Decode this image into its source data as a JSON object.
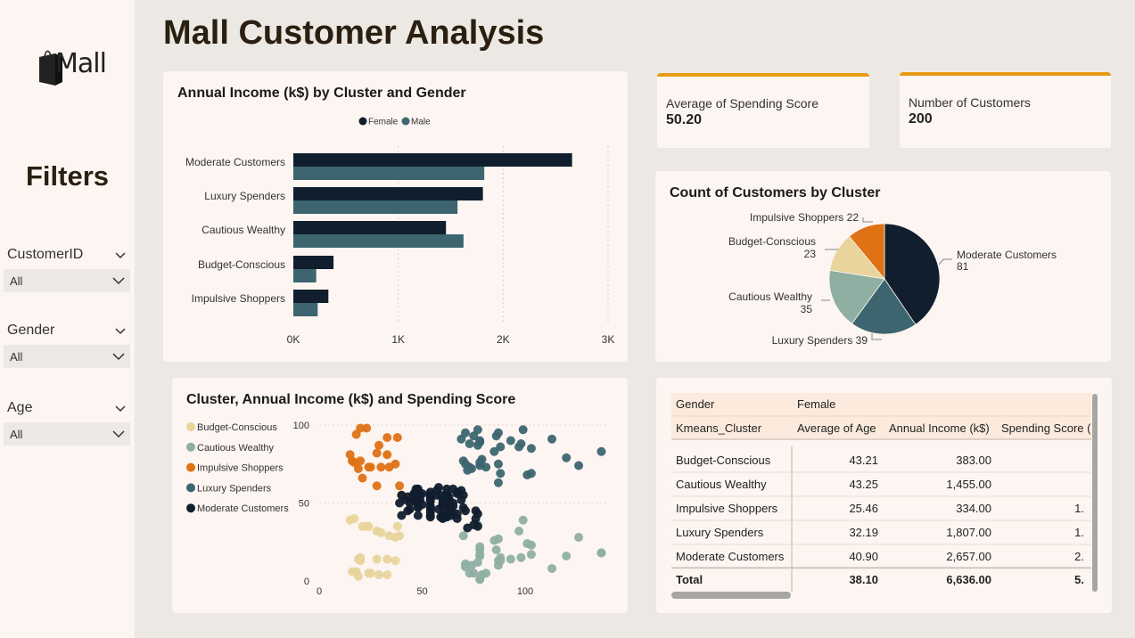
{
  "logo": {
    "text": "Mall"
  },
  "page_title": "Mall Customer Analysis",
  "filters": {
    "title": "Filters",
    "items": [
      {
        "label": "CustomerID",
        "value": "All"
      },
      {
        "label": "Gender",
        "value": "All"
      },
      {
        "label": "Age",
        "value": "All"
      }
    ]
  },
  "kpis": [
    {
      "label": "Average of Spending Score",
      "value": "50.20"
    },
    {
      "label": "Number of Customers",
      "value": "200"
    }
  ],
  "colors": {
    "female": "#111E2E",
    "male": "#3D6570",
    "budget": "#E8D49C",
    "cautious": "#8FAFA3",
    "impulsive": "#DE7215",
    "luxury": "#3D6570",
    "moderate": "#111E2E",
    "accent": "#E89A13"
  },
  "chart_data": [
    {
      "type": "bar",
      "orientation": "horizontal",
      "title": "Annual Income (k$) by Cluster and Gender",
      "categories": [
        "Moderate Customers",
        "Luxury Spenders",
        "Cautious Wealthy",
        "Budget-Conscious",
        "Impulsive Shoppers"
      ],
      "series": [
        {
          "name": "Female",
          "values": [
            2657,
            1807,
            1455,
            383,
            334
          ]
        },
        {
          "name": "Male",
          "values": [
            1820,
            1565,
            1622,
            218,
            232
          ]
        }
      ],
      "xlim": [
        0,
        3000
      ],
      "xticks": [
        "0K",
        "1K",
        "2K",
        "3K"
      ],
      "legend": "top-center",
      "grid": true
    },
    {
      "type": "pie",
      "title": "Count of Customers by Cluster",
      "slices": [
        {
          "label": "Moderate Customers",
          "value": 81
        },
        {
          "label": "Luxury Spenders",
          "value": 39
        },
        {
          "label": "Cautious Wealthy",
          "value": 35
        },
        {
          "label": "Budget-Conscious",
          "value": 23
        },
        {
          "label": "Impulsive Shoppers",
          "value": 22
        }
      ]
    },
    {
      "type": "scatter",
      "title": "Cluster, Annual Income (k$) and Spending Score",
      "xlim": [
        0,
        140
      ],
      "ylim": [
        0,
        100
      ],
      "xticks": [
        "0",
        "50",
        "100"
      ],
      "yticks": [
        "0",
        "50",
        "100"
      ],
      "legend": "left",
      "series": [
        {
          "name": "Budget-Conscious",
          "points": [
            [
              15,
              39
            ],
            [
              16,
              6
            ],
            [
              17,
              40
            ],
            [
              18,
              6
            ],
            [
              19,
              3
            ],
            [
              19,
              14
            ],
            [
              20,
              15
            ],
            [
              20,
              13
            ],
            [
              21,
              35
            ],
            [
              23,
              35
            ],
            [
              24,
              35
            ],
            [
              24,
              5
            ],
            [
              25,
              5
            ],
            [
              28,
              14
            ],
            [
              28,
              32
            ],
            [
              29,
              4
            ],
            [
              30,
              31
            ],
            [
              33,
              4
            ],
            [
              33,
              14
            ],
            [
              34,
              29
            ],
            [
              37,
              28
            ],
            [
              37,
              13
            ],
            [
              38,
              35
            ],
            [
              39,
              29
            ]
          ]
        },
        {
          "name": "Cautious Wealthy",
          "points": [
            [
              70,
              29
            ],
            [
              71,
              11
            ],
            [
              71,
              9
            ],
            [
              73,
              5
            ],
            [
              74,
              10
            ],
            [
              75,
              5
            ],
            [
              77,
              12
            ],
            [
              77,
              36
            ],
            [
              78,
              22
            ],
            [
              78,
              17
            ],
            [
              78,
              20
            ],
            [
              78,
              16
            ],
            [
              78,
              1
            ],
            [
              78,
              1
            ],
            [
              79,
              4
            ],
            [
              81,
              5
            ],
            [
              85,
              26
            ],
            [
              86,
              20
            ],
            [
              87,
              27
            ],
            [
              87,
              13
            ],
            [
              87,
              10
            ],
            [
              88,
              13
            ],
            [
              88,
              15
            ],
            [
              93,
              14
            ],
            [
              97,
              32
            ],
            [
              98,
              15
            ],
            [
              99,
              39
            ],
            [
              101,
              24
            ],
            [
              103,
              17
            ],
            [
              103,
              23
            ],
            [
              113,
              8
            ],
            [
              120,
              16
            ],
            [
              126,
              28
            ],
            [
              137,
              18
            ],
            [
              137,
              18
            ]
          ]
        },
        {
          "name": "Impulsive Shoppers",
          "points": [
            [
              15,
              81
            ],
            [
              16,
              77
            ],
            [
              17,
              76
            ],
            [
              18,
              94
            ],
            [
              19,
              72
            ],
            [
              20,
              77
            ],
            [
              20,
              98
            ],
            [
              21,
              66
            ],
            [
              23,
              98
            ],
            [
              24,
              73
            ],
            [
              25,
              73
            ],
            [
              28,
              82
            ],
            [
              28,
              61
            ],
            [
              29,
              87
            ],
            [
              30,
              73
            ],
            [
              33,
              92
            ],
            [
              33,
              81
            ],
            [
              34,
              73
            ],
            [
              37,
              75
            ],
            [
              38,
              92
            ],
            [
              39,
              61
            ],
            [
              40,
              55
            ]
          ]
        },
        {
          "name": "Luxury Spenders",
          "points": [
            [
              69,
              91
            ],
            [
              70,
              77
            ],
            [
              71,
              95
            ],
            [
              71,
              75
            ],
            [
              72,
              71
            ],
            [
              73,
              88
            ],
            [
              73,
              73
            ],
            [
              74,
              72
            ],
            [
              75,
              93
            ],
            [
              77,
              87
            ],
            [
              77,
              97
            ],
            [
              78,
              74
            ],
            [
              78,
              90
            ],
            [
              78,
              76
            ],
            [
              78,
              89
            ],
            [
              79,
              78
            ],
            [
              81,
              73
            ],
            [
              85,
              83
            ],
            [
              86,
              93
            ],
            [
              87,
              75
            ],
            [
              87,
              95
            ],
            [
              87,
              63
            ],
            [
              88,
              69
            ],
            [
              88,
              86
            ],
            [
              93,
              90
            ],
            [
              97,
              86
            ],
            [
              98,
              88
            ],
            [
              99,
              97
            ],
            [
              101,
              68
            ],
            [
              103,
              85
            ],
            [
              103,
              69
            ],
            [
              113,
              91
            ],
            [
              120,
              79
            ],
            [
              126,
              74
            ],
            [
              137,
              83
            ]
          ]
        },
        {
          "name": "Moderate Customers",
          "points": [
            [
              39,
              50
            ],
            [
              40,
              42
            ],
            [
              40,
              55
            ],
            [
              42,
              52
            ],
            [
              43,
              54
            ],
            [
              43,
              45
            ],
            [
              44,
              50
            ],
            [
              44,
              46
            ],
            [
              46,
              56
            ],
            [
              46,
              55
            ],
            [
              46,
              52
            ],
            [
              47,
              59
            ],
            [
              47,
              51
            ],
            [
              48,
              59
            ],
            [
              48,
              50
            ],
            [
              48,
              48
            ],
            [
              48,
              47
            ],
            [
              48,
              42
            ],
            [
              49,
              52
            ],
            [
              49,
              55
            ],
            [
              50,
              49
            ],
            [
              50,
              56
            ],
            [
              54,
              47
            ],
            [
              54,
              54
            ],
            [
              54,
              53
            ],
            [
              54,
              48
            ],
            [
              54,
              52
            ],
            [
              54,
              42
            ],
            [
              54,
              51
            ],
            [
              54,
              55
            ],
            [
              54,
              41
            ],
            [
              54,
              44
            ],
            [
              54,
              57
            ],
            [
              54,
              46
            ],
            [
              57,
              58
            ],
            [
              57,
              55
            ],
            [
              58,
              60
            ],
            [
              58,
              46
            ],
            [
              59,
              55
            ],
            [
              59,
              41
            ],
            [
              60,
              49
            ],
            [
              60,
              40
            ],
            [
              60,
              42
            ],
            [
              60,
              52
            ],
            [
              60,
              47
            ],
            [
              60,
              50
            ],
            [
              61,
              42
            ],
            [
              61,
              49
            ],
            [
              62,
              41
            ],
            [
              62,
              48
            ],
            [
              62,
              59
            ],
            [
              62,
              55
            ],
            [
              62,
              56
            ],
            [
              62,
              42
            ],
            [
              63,
              50
            ],
            [
              63,
              46
            ],
            [
              63,
              43
            ],
            [
              63,
              48
            ],
            [
              63,
              52
            ],
            [
              63,
              54
            ],
            [
              64,
              42
            ],
            [
              64,
              46
            ],
            [
              65,
              48
            ],
            [
              65,
              50
            ],
            [
              65,
              43
            ],
            [
              65,
              59
            ],
            [
              67,
              43
            ],
            [
              67,
              57
            ],
            [
              67,
              56
            ],
            [
              67,
              40
            ],
            [
              69,
              58
            ],
            [
              69,
              52
            ],
            [
              70,
              55
            ],
            [
              70,
              47
            ],
            [
              72,
              34
            ],
            [
              75,
              36
            ],
            [
              76,
              40
            ],
            [
              76,
              45
            ],
            [
              77,
              35
            ],
            [
              77,
              43
            ],
            [
              71,
              45
            ]
          ]
        }
      ]
    },
    {
      "type": "table",
      "column_group_header": {
        "label": "Gender",
        "value": "Female"
      },
      "columns": [
        "Kmeans_Cluster",
        "Average of Age",
        "Annual Income (k$)",
        "Spending Score ("
      ],
      "rows": [
        [
          "Budget-Conscious",
          "43.21",
          "383.00",
          ""
        ],
        [
          "Cautious Wealthy",
          "43.25",
          "1,455.00",
          ""
        ],
        [
          "Impulsive Shoppers",
          "25.46",
          "334.00",
          "1."
        ],
        [
          "Luxury Spenders",
          "32.19",
          "1,807.00",
          "1."
        ],
        [
          "Moderate Customers",
          "40.90",
          "2,657.00",
          "2."
        ]
      ],
      "total": [
        "Total",
        "38.10",
        "6,636.00",
        "5."
      ]
    }
  ]
}
